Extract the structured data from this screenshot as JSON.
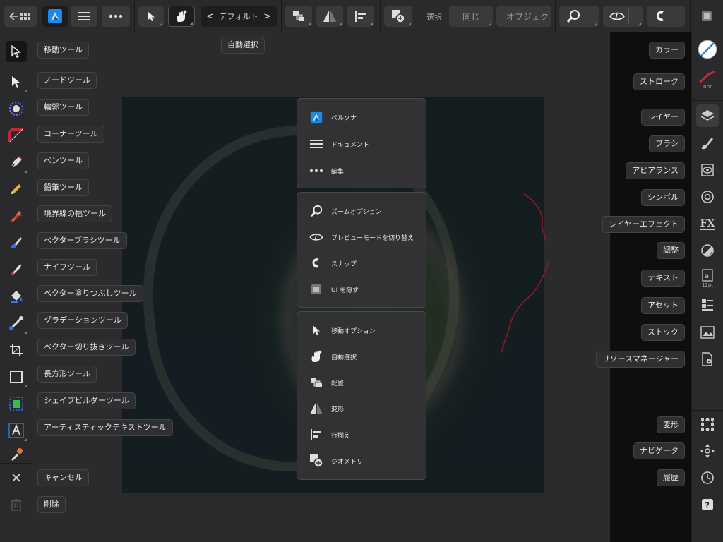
{
  "topbar": {
    "default_label": "デフォルト",
    "select_label": "選択",
    "same_label": "同じ",
    "object_label": "オブジェク",
    "tooltip_auto_select": "自動選択"
  },
  "left_tooltips": [
    "移動ツール",
    "ノードツール",
    "輪郭ツール",
    "コーナーツール",
    "ペンツール",
    "鉛筆ツール",
    "境界線の幅ツール",
    "ベクターブラシツール",
    "ナイフツール",
    "ベクター塗りつぶしツール",
    "グラデーションツール",
    "ベクター切り抜きツール",
    "長方形ツール",
    "シェイプビルダーツール",
    "アーティスティックテキストツール"
  ],
  "left_bottom": {
    "cancel": "キャンセル",
    "delete": "削除"
  },
  "right_tooltips": [
    "カラー",
    "ストローク",
    "レイヤー",
    "ブラシ",
    "アピアランス",
    "シンボル",
    "レイヤーエフェクト",
    "調整",
    "テキスト",
    "アセット",
    "ストック",
    "リソースマネージャー"
  ],
  "right_bottom_tooltips": [
    "変形",
    "ナビゲータ",
    "履歴"
  ],
  "right_sub": {
    "stroke_width": "0pt",
    "text_size": "12pt"
  },
  "menu": {
    "group1": [
      "ペルソナ",
      "ドキュメント",
      "編集"
    ],
    "group2": [
      "ズームオプション",
      "プレビューモードを切り替え",
      "スナップ",
      "UI を隠す"
    ],
    "group3": [
      "移動オプション",
      "自動選択",
      "配置",
      "変形",
      "行揃え",
      "ジオメトリ"
    ]
  },
  "colors": {
    "accent_blue": "#1e88e5",
    "stroke_red": "#c0283a"
  }
}
